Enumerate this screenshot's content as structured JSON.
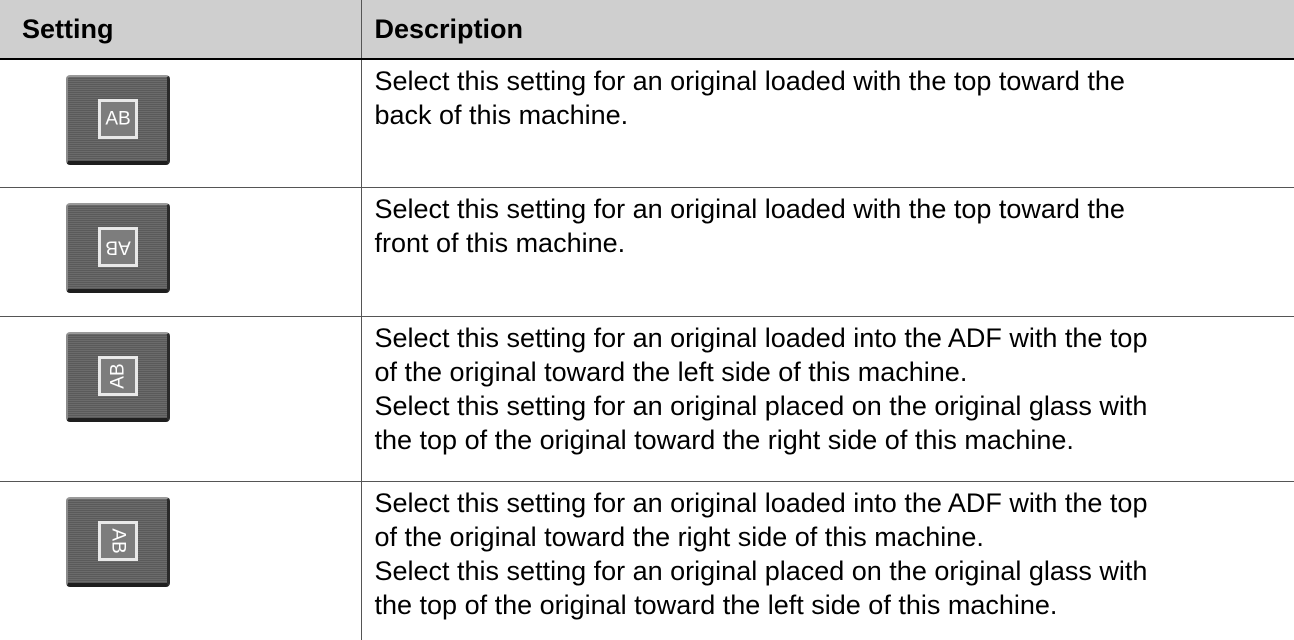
{
  "table": {
    "headers": {
      "setting": "Setting",
      "description": "Description"
    },
    "rows": [
      {
        "icon": "ab-upright-icon",
        "glyph": "AB",
        "description": "Select this setting for an original loaded with the top toward the\nback of this machine."
      },
      {
        "icon": "ab-upside-down-icon",
        "glyph": "AB",
        "description": "Select this setting for an original loaded with the top toward the\nfront of this machine."
      },
      {
        "icon": "ab-rotated-left-icon",
        "glyph": "AB",
        "description": "Select this setting for an original loaded into the ADF with the top\nof the original toward the left side of this machine.\nSelect this setting for an original placed on the original glass with\nthe top of the original toward the right side of this machine."
      },
      {
        "icon": "ab-rotated-right-icon",
        "glyph": "AB",
        "description": "Select this setting for an original loaded into the ADF with the top\nof the original toward the right side of this machine.\nSelect this setting for an original placed on the original glass with\nthe top of the original toward the left side of this machine."
      }
    ]
  }
}
